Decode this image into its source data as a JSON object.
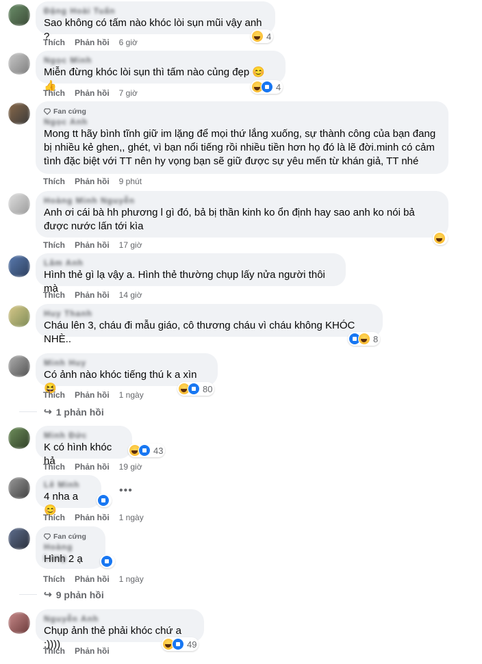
{
  "labels": {
    "like": "Thích",
    "reply": "Phản hồi"
  },
  "comments": [
    {
      "name": "Đặng Hoài Tuấn",
      "text": "Sao không có tấm nào khóc lòi sụn mũi vậy anh ?",
      "time": "6 giờ",
      "reaction_count": "4"
    },
    {
      "name": "Ngọc Minh",
      "text": "Miễn đừng khóc lòi sụn thì tấm nào củng đẹp",
      "emoji": "😊👍",
      "time": "7 giờ",
      "reaction_count": "4"
    },
    {
      "badge": "Fan cứng",
      "name": "Ngọc Anh",
      "text": "Mong tt hãy bình tĩnh giữ im lặng để mọi thứ lắng xuống, sự thành công của bạn đang bị nhiều kẻ ghen,, ghét, vì bạn nổi tiếng rồi nhiều tiền hơn họ đó là lẽ đời.minh có cảm tình đặc biệt với TT nên hy vọng bạn sẽ giữ được sự yêu mến từ khán giả, TT nhé",
      "time": "9 phút"
    },
    {
      "name": "Hoàng Minh Nguyễn",
      "text": "Anh ơi cái bà hh phương l gì đó, bả bị thần kinh ko ổn định hay sao anh ko nói bả được nước lấn tới kìa",
      "time": "17 giờ"
    },
    {
      "name": "Lâm Anh",
      "text": "Hình thẻ gì lạ vậy a. Hình thẻ thường chụp lấy nửa người thôi mà",
      "time": "14 giờ"
    },
    {
      "name": "Huy Thanh",
      "text": "Cháu lên 3, cháu đi mẫu giáo, cô thương cháu vì cháu không KHÓC NHÈ..",
      "time": "",
      "reaction_count": "8"
    },
    {
      "name": "Minh Huy",
      "text": "Có ảnh nào khóc tiếng thú k a xìn",
      "emoji": "😆",
      "time": "1 ngày",
      "reaction_count": "80",
      "replies": "1 phản hồi"
    },
    {
      "name": "Minh Đức",
      "text": "K có hình khóc hả",
      "time": "19 giờ",
      "reaction_count": "43"
    },
    {
      "name": "Lê Minh",
      "text": "4 nha a",
      "emoji": "😊",
      "time": "1 ngày"
    },
    {
      "badge": "Fan cứng",
      "name": "Hoàng Long",
      "text": "Hình 2 ạ",
      "time": "1 ngày",
      "replies": "9 phản hồi"
    },
    {
      "name": "Nguyễn Anh",
      "text": "Chụp ảnh thẻ phải khóc chứ a :))))",
      "time": "",
      "reaction_count": "49"
    }
  ]
}
